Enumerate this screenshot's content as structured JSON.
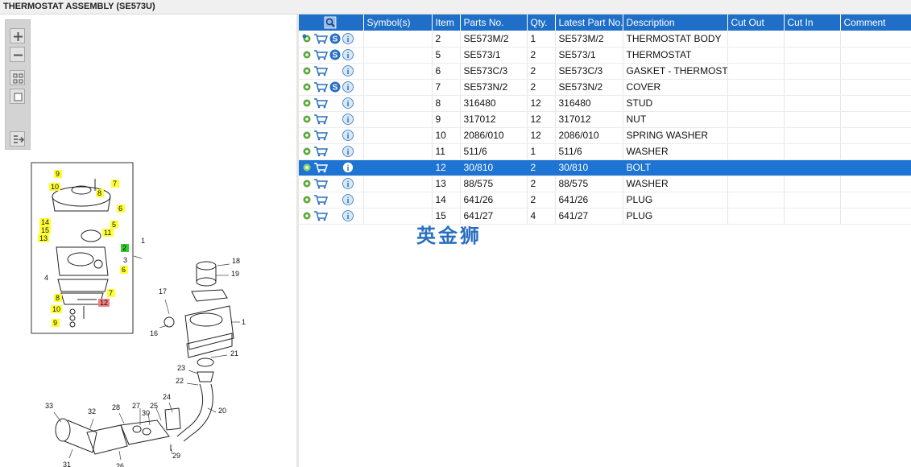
{
  "title": "THERMOSTAT ASSEMBLY (SE573U)",
  "watermark": "英金狮",
  "columns": [
    "",
    "Symbol(s)",
    "Item",
    "Parts No.",
    "Qty.",
    "Latest Part No.",
    "Description",
    "Cut Out",
    "Cut In",
    "Comment"
  ],
  "rows": [
    {
      "item": "2",
      "part": "SE573M/2",
      "qty": "1",
      "latest": "SE573M/2",
      "desc": "THERMOSTAT BODY",
      "tree": true,
      "s": true,
      "selected": false
    },
    {
      "item": "5",
      "part": "SE573/1",
      "qty": "2",
      "latest": "SE573/1",
      "desc": "THERMOSTAT",
      "tree": false,
      "s": true,
      "selected": false
    },
    {
      "item": "6",
      "part": "SE573C/3",
      "qty": "2",
      "latest": "SE573C/3",
      "desc": "GASKET - THERMOSTAT HOUSING",
      "tree": false,
      "s": false,
      "selected": false
    },
    {
      "item": "7",
      "part": "SE573N/2",
      "qty": "2",
      "latest": "SE573N/2",
      "desc": "COVER",
      "tree": false,
      "s": true,
      "selected": false
    },
    {
      "item": "8",
      "part": "316480",
      "qty": "12",
      "latest": "316480",
      "desc": "STUD",
      "tree": false,
      "s": false,
      "selected": false
    },
    {
      "item": "9",
      "part": "317012",
      "qty": "12",
      "latest": "317012",
      "desc": "NUT",
      "tree": false,
      "s": false,
      "selected": false
    },
    {
      "item": "10",
      "part": "2086/010",
      "qty": "12",
      "latest": "2086/010",
      "desc": "SPRING WASHER",
      "tree": false,
      "s": false,
      "selected": false
    },
    {
      "item": "11",
      "part": "511/6",
      "qty": "1",
      "latest": "511/6",
      "desc": "WASHER",
      "tree": false,
      "s": false,
      "selected": false
    },
    {
      "item": "12",
      "part": "30/810",
      "qty": "2",
      "latest": "30/810",
      "desc": "BOLT",
      "tree": false,
      "s": false,
      "selected": true
    },
    {
      "item": "13",
      "part": "88/575",
      "qty": "2",
      "latest": "88/575",
      "desc": "WASHER",
      "tree": false,
      "s": false,
      "selected": false
    },
    {
      "item": "14",
      "part": "641/26",
      "qty": "2",
      "latest": "641/26",
      "desc": "PLUG",
      "tree": false,
      "s": false,
      "selected": false
    },
    {
      "item": "15",
      "part": "641/27",
      "qty": "4",
      "latest": "641/27",
      "desc": "PLUG",
      "tree": false,
      "s": false,
      "selected": false
    }
  ],
  "toolbar": [
    "zoom-in-icon",
    "zoom-out-icon",
    "fit-all-icon",
    "fit-window-icon",
    "export-icon"
  ],
  "inset_labels": [
    "9",
    "7",
    "10",
    "8",
    "6",
    "14",
    "5",
    "15",
    "11",
    "13",
    "2",
    "1",
    "3",
    "4",
    "6",
    "7",
    "8",
    "12",
    "10",
    "9"
  ],
  "main_labels": [
    "18",
    "19",
    "17",
    "1",
    "16",
    "21",
    "23",
    "22",
    "20",
    "24",
    "33",
    "32",
    "28",
    "27",
    "25",
    "30",
    "31",
    "26",
    "29"
  ],
  "colors": {
    "header": "#1f6fc8",
    "selected": "#1e74d2",
    "callout_yellow": "#ffff33",
    "callout_green": "#33cc33",
    "callout_red": "#f08080"
  }
}
